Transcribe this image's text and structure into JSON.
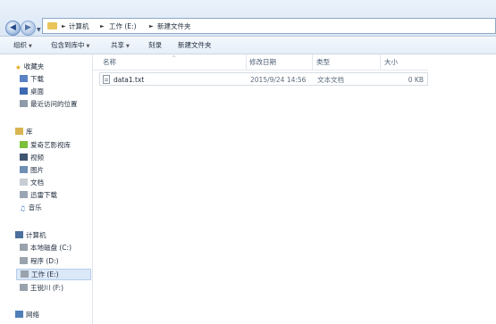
{
  "address": {
    "path": [
      "计算机",
      "工作 (E:)",
      "新建文件夹"
    ]
  },
  "toolbar": {
    "organize": "组织",
    "include_in_library": "包含到库中",
    "share": "共享",
    "burn": "刻录",
    "new_folder": "新建文件夹"
  },
  "nav": {
    "favorites": {
      "title": "收藏夹",
      "items": [
        "下载",
        "桌面",
        "最近访问的位置"
      ]
    },
    "libraries": {
      "title": "库",
      "items": [
        "爱奇艺影视库",
        "视频",
        "图片",
        "文档",
        "迅雷下载",
        "音乐"
      ]
    },
    "computer": {
      "title": "计算机",
      "items": [
        "本地磁盘 (C:)",
        "程序 (D:)",
        "工作 (E:)",
        "王锐川 (F:)"
      ],
      "selected": "工作 (E:)"
    },
    "network": {
      "title": "网络"
    }
  },
  "columns": {
    "name": "名称",
    "modified": "修改日期",
    "type": "类型",
    "size": "大小"
  },
  "files": [
    {
      "name": "data1.txt",
      "modified": "2015/9/24 14:56",
      "type": "文本文档",
      "size": "0 KB"
    }
  ]
}
